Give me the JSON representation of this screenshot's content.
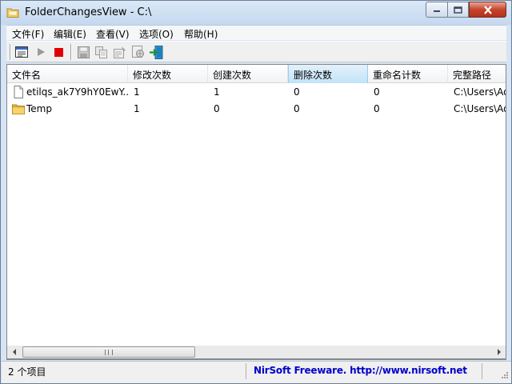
{
  "window": {
    "title": "FolderChangesView  -  C:\\"
  },
  "menu": [
    {
      "label": "文件(F)"
    },
    {
      "label": "编辑(E)"
    },
    {
      "label": "查看(V)"
    },
    {
      "label": "选项(O)"
    },
    {
      "label": "帮助(H)"
    }
  ],
  "toolbar": {
    "icons": [
      "select-folder-icon",
      "play-icon",
      "stop-icon",
      "save-icon",
      "copy-icon",
      "properties-icon",
      "html-report-icon",
      "exit-icon"
    ]
  },
  "columns": [
    {
      "label": "文件名"
    },
    {
      "label": "修改次数"
    },
    {
      "label": "创建次数"
    },
    {
      "label": "删除次数"
    },
    {
      "label": "重命名计数"
    },
    {
      "label": "完整路径"
    }
  ],
  "rows": [
    {
      "icon": "file-icon",
      "name": "etilqs_ak7Y9hY0EwY...",
      "modified": "1",
      "created": "1",
      "deleted": "0",
      "renamed": "0",
      "path": "C:\\Users\\Ad"
    },
    {
      "icon": "folder-icon",
      "name": "Temp",
      "modified": "1",
      "created": "0",
      "deleted": "0",
      "renamed": "0",
      "path": "C:\\Users\\Ad"
    }
  ],
  "status": {
    "count": "2 个项目",
    "link": "NirSoft Freeware.  http://www.nirsoft.net"
  },
  "colors": {
    "link": "#0000cc",
    "stop": "#e00000",
    "close_button": "#c4442c"
  }
}
